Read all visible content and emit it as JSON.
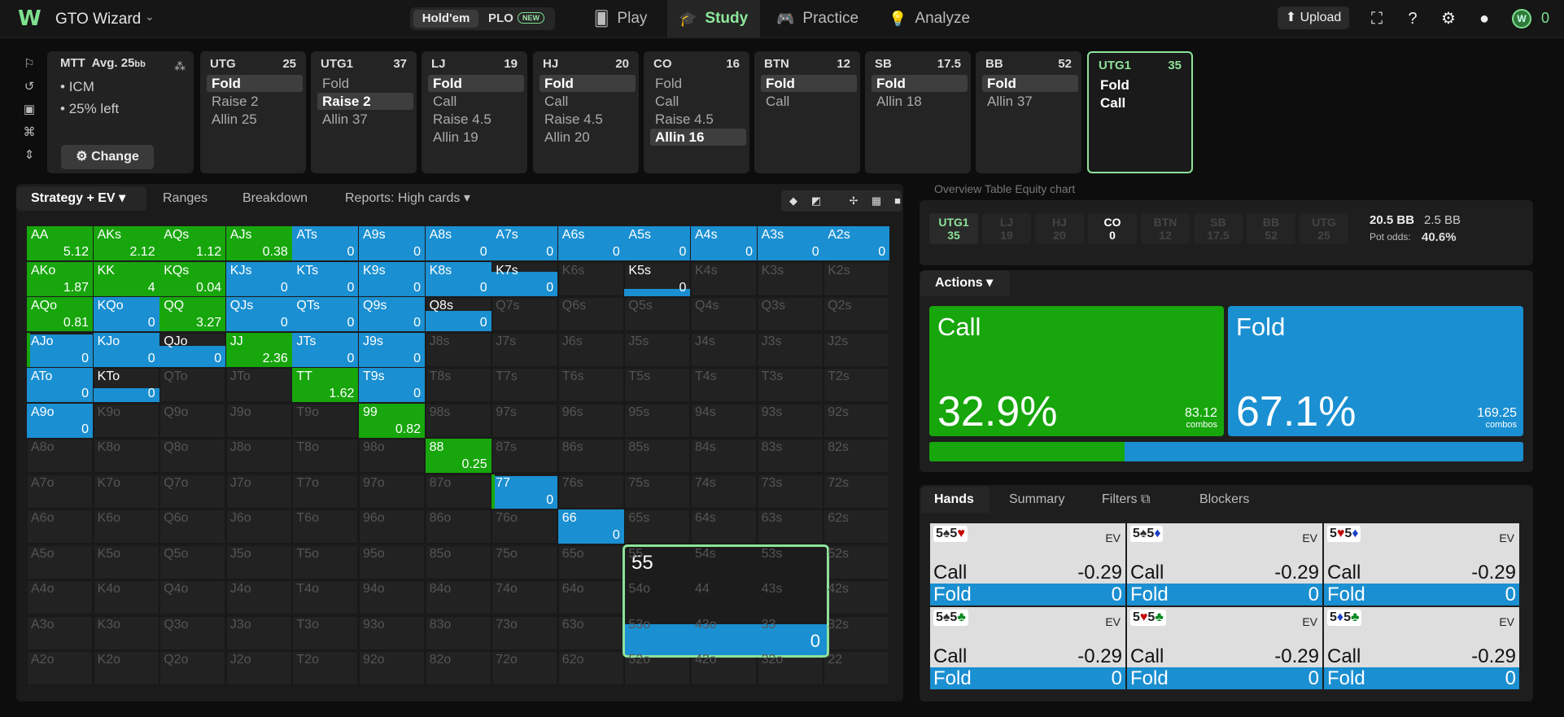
{
  "app": {
    "title": "GTO Wizard",
    "logo": "W"
  },
  "game_toggle": {
    "holdem": "Hold'em",
    "plo": "PLO",
    "new_badge": "NEW"
  },
  "nav": {
    "play": "Play",
    "study": "Study",
    "practice": "Practice",
    "analyze": "Analyze"
  },
  "topbar": {
    "upload": "Upload",
    "coins": "0"
  },
  "mtt": {
    "title": "MTT",
    "avg": "Avg. 25",
    "avg_unit": "bb",
    "icm": "ICM",
    "left": "25% left",
    "change": "Change"
  },
  "positions": [
    {
      "name": "UTG",
      "stack": "25",
      "options": [
        "Fold",
        "Raise 2",
        "Allin 25"
      ],
      "hl": 0
    },
    {
      "name": "UTG1",
      "stack": "37",
      "options": [
        "Fold",
        "Raise 2",
        "Allin 37"
      ],
      "hl": 1
    },
    {
      "name": "LJ",
      "stack": "19",
      "options": [
        "Fold",
        "Call",
        "Raise 4.5",
        "Allin 19"
      ],
      "hl": 0
    },
    {
      "name": "HJ",
      "stack": "20",
      "options": [
        "Fold",
        "Call",
        "Raise 4.5",
        "Allin 20"
      ],
      "hl": 0
    },
    {
      "name": "CO",
      "stack": "16",
      "options": [
        "Fold",
        "Call",
        "Raise 4.5",
        "Allin 16"
      ],
      "hl": 3
    },
    {
      "name": "BTN",
      "stack": "12",
      "options": [
        "Fold",
        "Call"
      ],
      "hl": 0
    },
    {
      "name": "SB",
      "stack": "17.5",
      "options": [
        "Fold",
        "Allin 18"
      ],
      "hl": 0
    },
    {
      "name": "BB",
      "stack": "52",
      "options": [
        "Fold",
        "Allin 37"
      ],
      "hl": 0
    },
    {
      "name": "UTG1",
      "stack": "35",
      "options": [
        "Fold",
        "Call"
      ],
      "hl": -1
    }
  ],
  "strategy_tabs": {
    "strategy_ev": "Strategy + EV",
    "ranges": "Ranges",
    "breakdown": "Breakdown",
    "reports": "Reports: High cards"
  },
  "colors": {
    "call": "#17a60c",
    "fold": "#1a8fd1",
    "accent": "#8ee29a"
  },
  "grid": {
    "rows": [
      [
        "AA",
        "AKs",
        "AQs",
        "AJs",
        "ATs",
        "A9s",
        "A8s",
        "A7s",
        "A6s",
        "A5s",
        "A4s",
        "A3s",
        "A2s"
      ],
      [
        "AKo",
        "KK",
        "KQs",
        "KJs",
        "KTs",
        "K9s",
        "K8s",
        "K7s",
        "K6s",
        "K5s",
        "K4s",
        "K3s",
        "K2s"
      ],
      [
        "AQo",
        "KQo",
        "QQ",
        "QJs",
        "QTs",
        "Q9s",
        "Q8s",
        "Q7s",
        "Q6s",
        "Q5s",
        "Q4s",
        "Q3s",
        "Q2s"
      ],
      [
        "AJo",
        "KJo",
        "QJo",
        "JJ",
        "JTs",
        "J9s",
        "J8s",
        "J7s",
        "J6s",
        "J5s",
        "J4s",
        "J3s",
        "J2s"
      ],
      [
        "ATo",
        "KTo",
        "QTo",
        "JTo",
        "TT",
        "T9s",
        "T8s",
        "T7s",
        "T6s",
        "T5s",
        "T4s",
        "T3s",
        "T2s"
      ],
      [
        "A9o",
        "K9o",
        "Q9o",
        "J9o",
        "T9o",
        "99",
        "98s",
        "97s",
        "96s",
        "95s",
        "94s",
        "93s",
        "92s"
      ],
      [
        "A8o",
        "K8o",
        "Q8o",
        "J8o",
        "T8o",
        "98o",
        "88",
        "87s",
        "86s",
        "85s",
        "84s",
        "83s",
        "82s"
      ],
      [
        "A7o",
        "K7o",
        "Q7o",
        "J7o",
        "T7o",
        "97o",
        "87o",
        "77",
        "76s",
        "75s",
        "74s",
        "73s",
        "72s"
      ],
      [
        "A6o",
        "K6o",
        "Q6o",
        "J6o",
        "T6o",
        "96o",
        "86o",
        "76o",
        "66",
        "65s",
        "64s",
        "63s",
        "62s"
      ],
      [
        "A5o",
        "K5o",
        "Q5o",
        "J5o",
        "T5o",
        "95o",
        "85o",
        "75o",
        "65o",
        "55",
        "54s",
        "53s",
        "52s"
      ],
      [
        "A4o",
        "K4o",
        "Q4o",
        "J4o",
        "T4o",
        "94o",
        "84o",
        "74o",
        "64o",
        "54o",
        "44",
        "43s",
        "42s"
      ],
      [
        "A3o",
        "K3o",
        "Q3o",
        "J3o",
        "T3o",
        "93o",
        "83o",
        "73o",
        "63o",
        "53o",
        "43o",
        "33",
        "32s"
      ],
      [
        "A2o",
        "K2o",
        "Q2o",
        "J2o",
        "T2o",
        "92o",
        "82o",
        "72o",
        "62o",
        "52o",
        "42o",
        "32o",
        "22"
      ]
    ],
    "active": {
      "AA": {
        "call": 1,
        "fold": 0,
        "ev": "5.12"
      },
      "AKs": {
        "call": 1,
        "fold": 0,
        "ev": "2.12"
      },
      "AQs": {
        "call": 1,
        "fold": 0,
        "ev": "1.12"
      },
      "AJs": {
        "call": 1,
        "fold": 0,
        "ev": "0.38"
      },
      "ATs": {
        "call": 0,
        "fold": 1,
        "ev": "0"
      },
      "A9s": {
        "call": 0,
        "fold": 1,
        "ev": "0"
      },
      "A8s": {
        "call": 0,
        "fold": 1,
        "ev": "0"
      },
      "A7s": {
        "call": 0,
        "fold": 1,
        "ev": "0"
      },
      "A6s": {
        "call": 0,
        "fold": 1,
        "ev": "0"
      },
      "A5s": {
        "call": 0,
        "fold": 1,
        "ev": "0"
      },
      "A4s": {
        "call": 0,
        "fold": 1,
        "ev": "0"
      },
      "A3s": {
        "call": 0,
        "fold": 1,
        "ev": "0"
      },
      "A2s": {
        "call": 0,
        "fold": 1,
        "ev": "0"
      },
      "AKo": {
        "call": 1,
        "fold": 0,
        "ev": "1.87"
      },
      "KK": {
        "call": 1,
        "fold": 0,
        "ev": "4"
      },
      "KQs": {
        "call": 1,
        "fold": 0,
        "ev": "0.04"
      },
      "KJs": {
        "call": 0,
        "fold": 1,
        "ev": "0"
      },
      "KTs": {
        "call": 0,
        "fold": 1,
        "ev": "0"
      },
      "K9s": {
        "call": 0,
        "fold": 1,
        "ev": "0"
      },
      "K8s": {
        "call": 0,
        "fold": 1,
        "ev": "0"
      },
      "K7s": {
        "call": 0,
        "fold": 0.7,
        "ev": "0"
      },
      "K5s": {
        "call": 0,
        "fold": 0.2,
        "ev": "0"
      },
      "AQo": {
        "call": 1,
        "fold": 0,
        "ev": "0.81"
      },
      "KQo": {
        "call": 0,
        "fold": 1,
        "ev": "0"
      },
      "QQ": {
        "call": 1,
        "fold": 0,
        "ev": "3.27"
      },
      "QJs": {
        "call": 0,
        "fold": 1,
        "ev": "0"
      },
      "QTs": {
        "call": 0,
        "fold": 1,
        "ev": "0"
      },
      "Q9s": {
        "call": 0,
        "fold": 1,
        "ev": "0"
      },
      "Q8s": {
        "call": 0,
        "fold": 0.6,
        "ev": "0"
      },
      "AJo": {
        "call": 0.05,
        "fold": 0.95,
        "ev": "0"
      },
      "KJo": {
        "call": 0,
        "fold": 1,
        "ev": "0"
      },
      "QJo": {
        "call": 0,
        "fold": 0.6,
        "ev": "0"
      },
      "JJ": {
        "call": 1,
        "fold": 0,
        "ev": "2.36"
      },
      "JTs": {
        "call": 0,
        "fold": 1,
        "ev": "0"
      },
      "J9s": {
        "call": 0,
        "fold": 1,
        "ev": "0"
      },
      "ATo": {
        "call": 0,
        "fold": 1,
        "ev": "0"
      },
      "KTo": {
        "call": 0,
        "fold": 0.4,
        "ev": "0"
      },
      "TT": {
        "call": 1,
        "fold": 0,
        "ev": "1.62"
      },
      "T9s": {
        "call": 0,
        "fold": 1,
        "ev": "0"
      },
      "A9o": {
        "call": 0,
        "fold": 1,
        "ev": "0"
      },
      "99": {
        "call": 1,
        "fold": 0,
        "ev": "0.82"
      },
      "88": {
        "call": 1,
        "fold": 0,
        "ev": "0.25"
      },
      "77": {
        "call": 0.05,
        "fold": 0.95,
        "ev": "0"
      },
      "66": {
        "call": 0,
        "fold": 1,
        "ev": "0"
      }
    }
  },
  "popup": {
    "hand": "55",
    "ev": "0"
  },
  "overview": {
    "tabs": "Overview   Table   Equity chart",
    "seats": [
      {
        "name": "UTG1",
        "stack": "35",
        "state": "hero"
      },
      {
        "name": "LJ",
        "stack": "19",
        "state": "folded"
      },
      {
        "name": "HJ",
        "stack": "20",
        "state": "folded"
      },
      {
        "name": "CO",
        "stack": "0",
        "state": "act"
      },
      {
        "name": "BTN",
        "stack": "12",
        "state": "folded"
      },
      {
        "name": "SB",
        "stack": "17.5",
        "state": "folded"
      },
      {
        "name": "BB",
        "stack": "52",
        "state": "folded"
      },
      {
        "name": "UTG",
        "stack": "25",
        "state": "folded"
      }
    ],
    "pot": "20.5 BB",
    "to_call": "2.5 BB",
    "pot_odds_label": "Pot odds:",
    "pot_odds": "40.6%"
  },
  "actions": {
    "tab": "Actions",
    "call": {
      "label": "Call",
      "pct": "32.9%",
      "combos": "83.12",
      "combos_label": "combos",
      "frac": 0.329
    },
    "fold": {
      "label": "Fold",
      "pct": "67.1%",
      "combos": "169.25",
      "combos_label": "combos",
      "frac": 0.671
    }
  },
  "hands_tabs": {
    "hands": "Hands",
    "summary": "Summary",
    "filters": "Filters",
    "blockers": "Blockers"
  },
  "hand_cards": [
    {
      "c1": "5",
      "s1": "♠",
      "k1": "dark",
      "c2": "5",
      "s2": "♥",
      "k2": "red",
      "ev_label": "EV",
      "call": "Call",
      "call_val": "-0.29",
      "fold": "Fold",
      "fold_val": "0"
    },
    {
      "c1": "5",
      "s1": "♠",
      "k1": "dark",
      "c2": "5",
      "s2": "♦",
      "k2": "blue",
      "ev_label": "EV",
      "call": "Call",
      "call_val": "-0.29",
      "fold": "Fold",
      "fold_val": "0"
    },
    {
      "c1": "5",
      "s1": "♥",
      "k1": "red",
      "c2": "5",
      "s2": "♦",
      "k2": "blue",
      "ev_label": "EV",
      "call": "Call",
      "call_val": "-0.29",
      "fold": "Fold",
      "fold_val": "0"
    },
    {
      "c1": "5",
      "s1": "♠",
      "k1": "dark",
      "c2": "5",
      "s2": "♣",
      "k2": "green",
      "ev_label": "EV",
      "call": "Call",
      "call_val": "-0.29",
      "fold": "Fold",
      "fold_val": "0"
    },
    {
      "c1": "5",
      "s1": "♥",
      "k1": "red",
      "c2": "5",
      "s2": "♣",
      "k2": "green",
      "ev_label": "EV",
      "call": "Call",
      "call_val": "-0.29",
      "fold": "Fold",
      "fold_val": "0"
    },
    {
      "c1": "5",
      "s1": "♦",
      "k1": "blue",
      "c2": "5",
      "s2": "♣",
      "k2": "green",
      "ev_label": "EV",
      "call": "Call",
      "call_val": "-0.29",
      "fold": "Fold",
      "fold_val": "0"
    }
  ]
}
